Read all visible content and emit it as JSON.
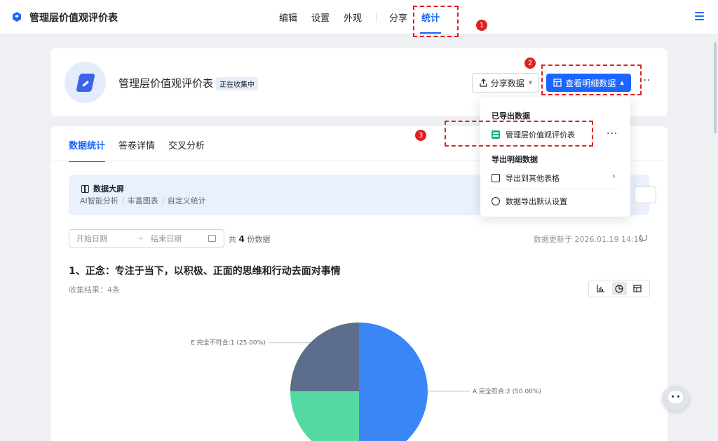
{
  "app": {
    "title": "管理层价值观评价表"
  },
  "nav": {
    "edit": "编辑",
    "settings": "设置",
    "appearance": "外观",
    "share": "分享",
    "stats": "统计"
  },
  "header": {
    "form_title": "管理层价值观评价表",
    "status_badge": "正在收集中",
    "share_data_label": "分享数据",
    "view_detail_label": "查看明细数据",
    "more_label": "···"
  },
  "tabs": {
    "data_stats": "数据统计",
    "answer_detail": "答卷详情",
    "cross_analysis": "交叉分析"
  },
  "banner": {
    "title": "数据大屏",
    "tags": [
      "AI智能分析",
      "丰富图表",
      "自定义统计"
    ]
  },
  "filter": {
    "start_placeholder": "开始日期",
    "arrow": "→",
    "end_placeholder": "结束日期",
    "count_prefix": "共",
    "count_value": "4",
    "count_suffix": "份数据",
    "updated": "数据更新于 2026.01.19 14:10"
  },
  "question": {
    "title": "1、正念：专注于当下，以积极、正面的思维和行动去面对事情",
    "subtitle": "收集结果：4条"
  },
  "dropdown": {
    "group_exported": "已导出数据",
    "exported_item": "管理层价值观评价表",
    "more": "···",
    "group_export_detail": "导出明细数据",
    "export_other": "导出到其他表格",
    "chevron": "›",
    "export_settings": "数据导出默认设置"
  },
  "annotations": {
    "m1": "1",
    "m2": "2",
    "m3": "3"
  },
  "colors": {
    "accent": "#1a66ff",
    "annotation": "#e02020",
    "sheet_green": "#21b07a"
  },
  "chart_data": {
    "type": "pie",
    "series": [
      {
        "label": "A 完全符合:2 (50.00%)",
        "value": 2,
        "color": "#3a86f7"
      },
      {
        "label": "",
        "value": 1,
        "color": "#55d9a3"
      },
      {
        "label": "E 完全不符合:1 (25.00%)",
        "value": 1,
        "color": "#5d6e8c"
      }
    ]
  }
}
